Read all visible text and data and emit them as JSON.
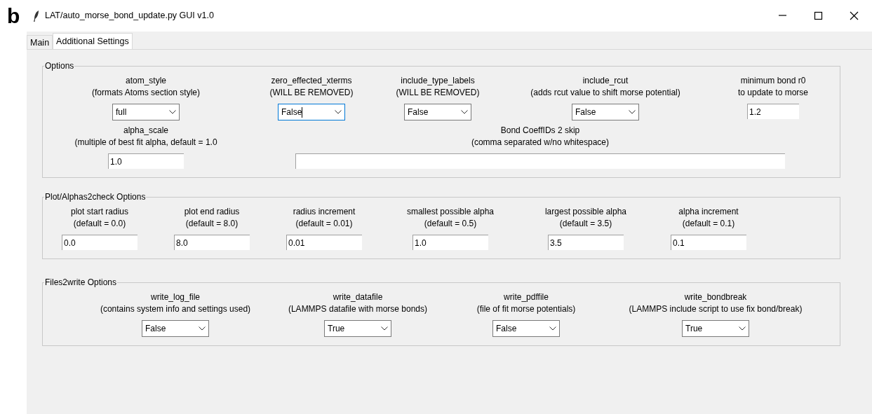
{
  "panel_label": "b",
  "window": {
    "title": "LAT/auto_morse_bond_update.py GUI v1.0"
  },
  "tabs": [
    {
      "label": "Main",
      "selected": false
    },
    {
      "label": "Additional Settings",
      "selected": true
    }
  ],
  "groups": [
    {
      "title": "Options",
      "rows": [
        [
          {
            "label": "atom_style",
            "note": "(formats Atoms section style)",
            "kind": "combobox",
            "value": "full",
            "focused": false
          },
          {
            "label": "zero_effected_xterms",
            "note": "(WILL BE REMOVED)",
            "kind": "combobox",
            "value": "False",
            "focused": true
          },
          {
            "label": "include_type_labels",
            "note": "(WILL BE REMOVED)",
            "kind": "combobox",
            "value": "False",
            "focused": false
          },
          {
            "label": "include_rcut",
            "note": "(adds rcut value to shift morse potential)",
            "kind": "combobox",
            "value": "False",
            "focused": false
          },
          {
            "label": "minimum bond r0",
            "note": "to update to morse",
            "kind": "entry",
            "value": "1.2"
          }
        ],
        [
          {
            "label": "alpha_scale",
            "note": "(multiple of best fit alpha, default = 1.0",
            "kind": "entry",
            "value": "1.0"
          },
          {
            "label": "Bond CoeffIDs 2 skip",
            "note": "(comma separated w/no whitespace)",
            "kind": "wide_entry"
          }
        ]
      ]
    },
    {
      "title": "Plot/Alphas2check Options",
      "rows": [
        [
          {
            "label": "plot start radius",
            "note": "(default = 0.0)",
            "kind": "entry",
            "value": "0.0"
          },
          {
            "label": "plot end radius",
            "note": "(default = 8.0)",
            "kind": "entry",
            "value": "8.0"
          },
          {
            "label": "radius increment",
            "note": "(default = 0.01)",
            "kind": "entry",
            "value": "0.01"
          },
          {
            "label": "smallest possible alpha",
            "note": "(default = 0.5)",
            "kind": "entry",
            "value": "1.0"
          },
          {
            "label": "largest possible alpha",
            "note": "(default = 3.5)",
            "kind": "entry",
            "value": "3.5"
          },
          {
            "label": "alpha increment",
            "note": "(default = 0.1)",
            "kind": "entry",
            "value": "0.1"
          }
        ]
      ]
    },
    {
      "title": "Files2write Options",
      "rows": [
        [
          {
            "label": "write_log_file",
            "note": "(contains system info and settings used)",
            "kind": "combobox",
            "value": "False",
            "focused": false
          },
          {
            "label": "write_datafile",
            "note": "(LAMMPS datafile with morse bonds)",
            "kind": "combobox",
            "value": "True",
            "focused": false
          },
          {
            "label": "write_pdffile",
            "note": "(file of fit morse potentials)",
            "kind": "combobox",
            "value": "False",
            "focused": false
          },
          {
            "label": "write_bondbreak",
            "note": "(LAMMPS include script to use fix bond/break)",
            "kind": "combobox",
            "value": "True",
            "focused": false
          }
        ]
      ]
    }
  ]
}
